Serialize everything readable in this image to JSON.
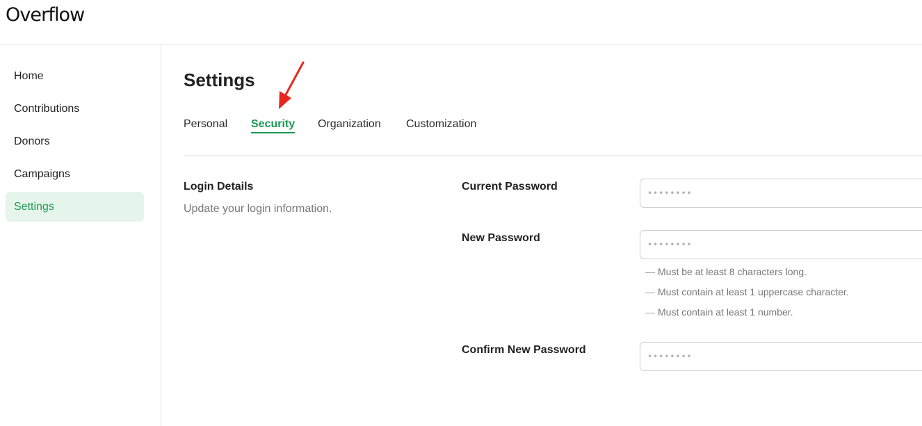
{
  "app": {
    "logo": "Overflow"
  },
  "sidebar": {
    "items": [
      {
        "label": "Home"
      },
      {
        "label": "Contributions"
      },
      {
        "label": "Donors"
      },
      {
        "label": "Campaigns"
      },
      {
        "label": "Settings",
        "active": true
      }
    ]
  },
  "page": {
    "title": "Settings",
    "tabs": [
      {
        "label": "Personal"
      },
      {
        "label": "Security",
        "active": true
      },
      {
        "label": "Organization"
      },
      {
        "label": "Customization"
      }
    ]
  },
  "login": {
    "title": "Login Details",
    "description": "Update your login information.",
    "current_password": {
      "label": "Current Password",
      "placeholder": "••••••••"
    },
    "new_password": {
      "label": "New Password",
      "placeholder": "••••••••",
      "hints": [
        "Must be at least 8 characters long.",
        "Must contain at least 1 uppercase character.",
        "Must contain at least 1 number."
      ],
      "hint_dash": "—"
    },
    "confirm_password": {
      "label": "Confirm New Password",
      "placeholder": "••••••••"
    }
  },
  "colors": {
    "accent": "#1a9a52",
    "active_bg": "#e6f5ec",
    "annotation_arrow": "#e8281e"
  },
  "icons": {
    "annotation": "red-arrow-icon"
  }
}
